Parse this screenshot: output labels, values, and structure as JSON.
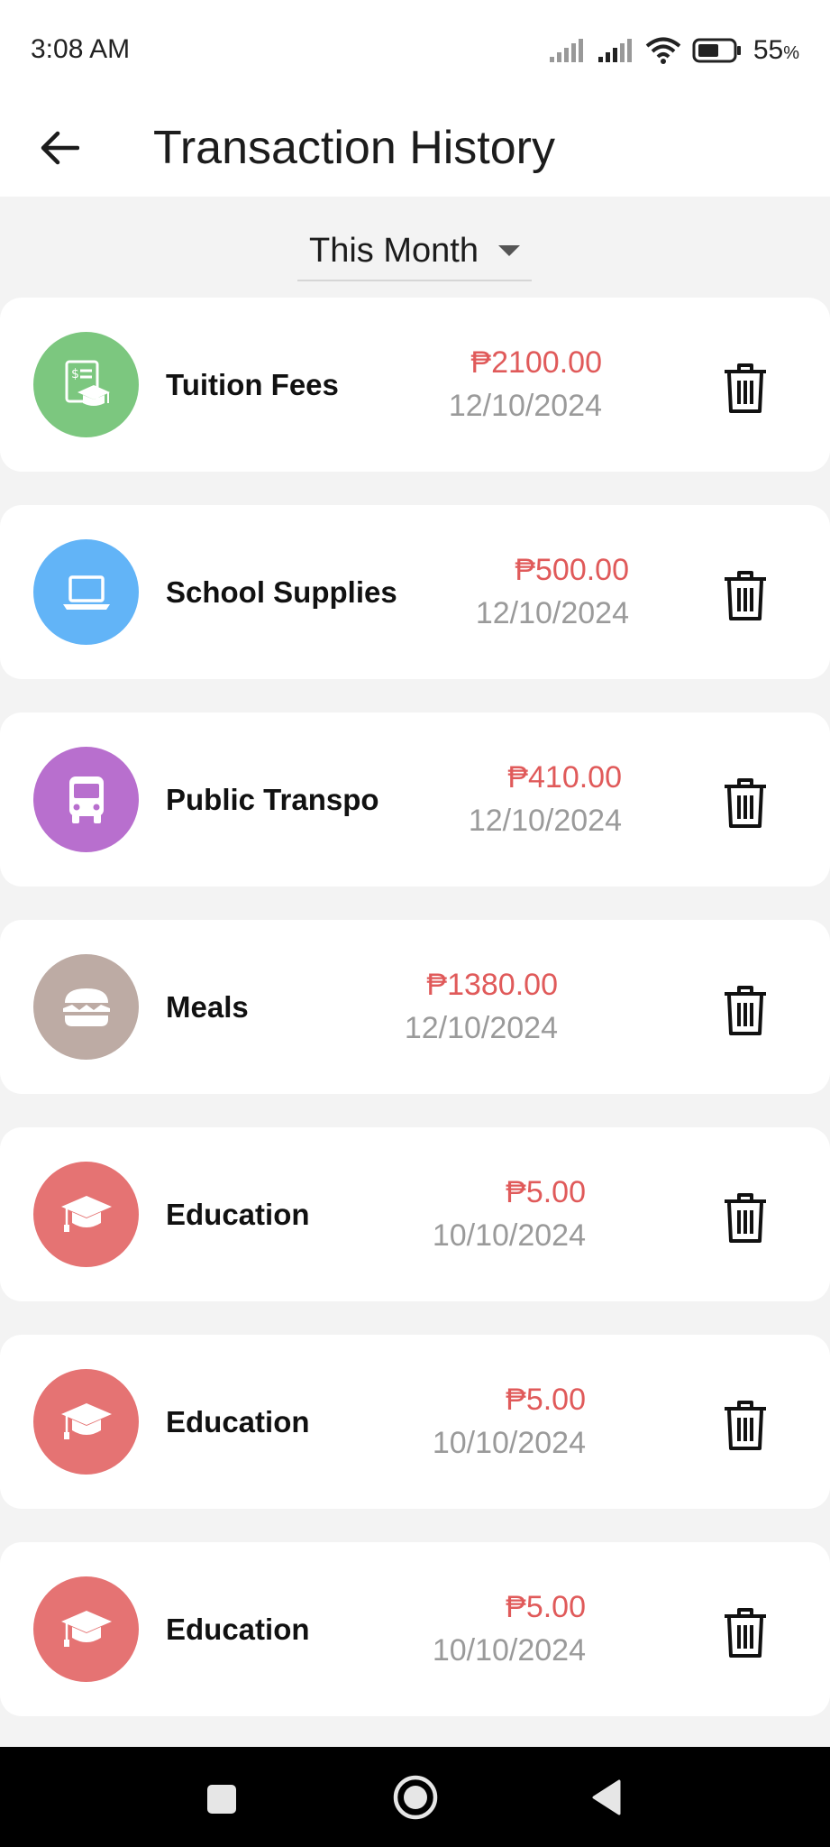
{
  "status_bar": {
    "time": "3:08 AM",
    "battery_percent": "55",
    "battery_unit": "%",
    "icons": [
      "signal-icon",
      "signal-icon",
      "wifi-icon",
      "battery-icon"
    ]
  },
  "app_bar": {
    "title": "Transaction History",
    "back_icon": "arrow-left-icon"
  },
  "filter": {
    "selected": "This Month"
  },
  "colors": {
    "amount": "#e05a5a",
    "date": "#9a9a9a",
    "tuition": "#7cc77f",
    "supplies": "#62b4f7",
    "transport": "#b86fce",
    "meals": "#bdaba4",
    "education": "#e57373"
  },
  "transactions": [
    {
      "category": "Tuition Fees",
      "amount": "₱2100.00",
      "date": "12/10/2024",
      "icon": "tuition-icon",
      "color": "#7cc77f"
    },
    {
      "category": "School Supplies",
      "amount": "₱500.00",
      "date": "12/10/2024",
      "icon": "laptop-icon",
      "color": "#62b4f7"
    },
    {
      "category": "Public Transpo",
      "amount": "₱410.00",
      "date": "12/10/2024",
      "icon": "bus-icon",
      "color": "#b86fce"
    },
    {
      "category": "Meals",
      "amount": "₱1380.00",
      "date": "12/10/2024",
      "icon": "burger-icon",
      "color": "#bdaba4"
    },
    {
      "category": "Education",
      "amount": "₱5.00",
      "date": "10/10/2024",
      "icon": "graduation-cap-icon",
      "color": "#e57373"
    },
    {
      "category": "Education",
      "amount": "₱5.00",
      "date": "10/10/2024",
      "icon": "graduation-cap-icon",
      "color": "#e57373"
    },
    {
      "category": "Education",
      "amount": "₱5.00",
      "date": "10/10/2024",
      "icon": "graduation-cap-icon",
      "color": "#e57373"
    }
  ]
}
